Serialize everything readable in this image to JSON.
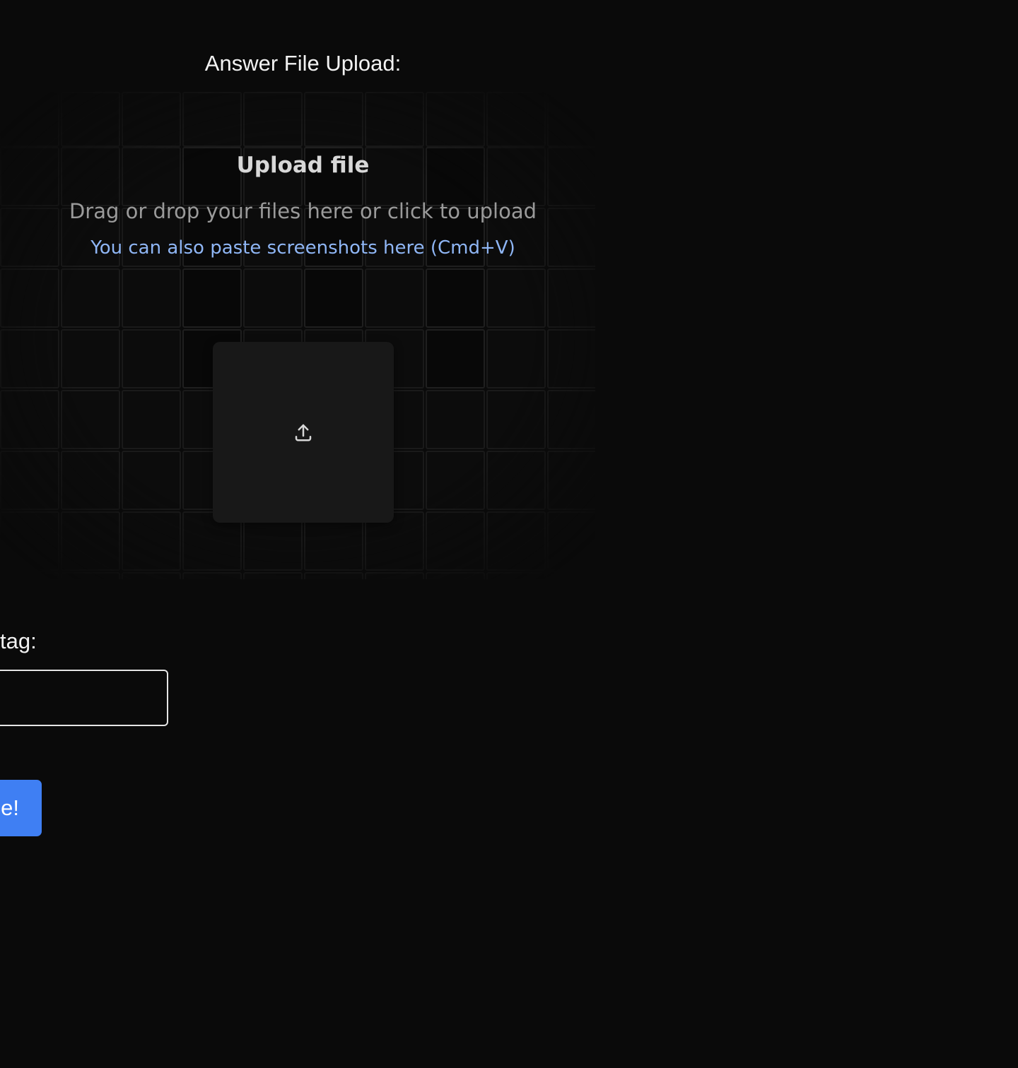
{
  "upload_section": {
    "label": "Answer File Upload:",
    "dropzone": {
      "title": "Upload file",
      "description": "Drag or drop your files here or click to upload",
      "paste_hint": "You can also paste screenshots here (Cmd+V)",
      "icon": "upload-icon"
    }
  },
  "tag_field": {
    "label": "tag:",
    "value": "",
    "placeholder": ""
  },
  "submit": {
    "label": "e!"
  },
  "colors": {
    "background": "#0a0a0a",
    "dropzone_box": "#181818",
    "accent_blue": "#3f7ff3",
    "link_blue": "#8fb6f5"
  }
}
